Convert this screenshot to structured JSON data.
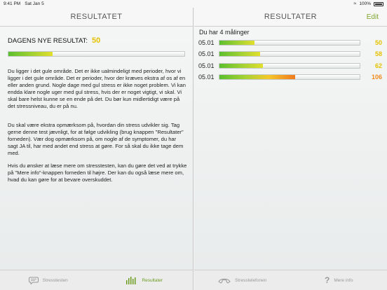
{
  "status_bar": {
    "time": "9:41 PM",
    "date": "Sat Jan 5",
    "battery": "100%"
  },
  "left_pane": {
    "title": "RESULTATET",
    "result_label": "DAGENS NYE RESULTAT:",
    "result_value": "50",
    "result_fraction": 0.25,
    "paragraphs": [
      "Du ligger i det gule område. Det er ikke ualmindeligt med perioder, hvor vi ligger i det gule område. Det er perioder, hvor der kræves ekstra af os af en eller anden grund. Nogle dage med gul stress er ikke noget problem. Vi kan endda klare nogle uger med gul stress, hvis der er noget vigtigt, vi skal. Vi skal bare helst kunne se en ende på det. Du bør kun midlertidigt være på det stressniveau, du er på nu.",
      "Du skal være ekstra opmærksom på, hvordan din stress udvikler sig. Tag gerne denne test jævnligt, for at følge udvikling (brug knappen \"Resultater\" forneden). Vær dog opmærksom på, om nogle af de symptomer, du har sagt JA til, har med andet end stress at gøre. For så skal du ikke tage dem med.",
      "Hvis du ønsker at læse mere om stresstesten, kan du gøre det ved at trykke på \"Mere info\"-knappen forneden til højre. Der kan du også læse mere om, hvad du kan gøre for at bevare overskuddet."
    ]
  },
  "right_pane": {
    "title": "RESULTATER",
    "edit_label": "Edit",
    "count_label": "Du har 4 målinger",
    "measurements": [
      {
        "date": "05.01",
        "value": "50",
        "fraction": 0.25,
        "color": "#e6c200"
      },
      {
        "date": "05.01",
        "value": "58",
        "fraction": 0.29,
        "color": "#e6c200"
      },
      {
        "date": "05.01",
        "value": "62",
        "fraction": 0.31,
        "color": "#e6c200"
      },
      {
        "date": "05.01",
        "value": "106",
        "fraction": 0.54,
        "color": "#f08a1e"
      }
    ]
  },
  "tabs": [
    {
      "label": "Stresstesten",
      "icon": "chat-bubble-icon",
      "active": false
    },
    {
      "label": "Resultater",
      "icon": "bar-chart-icon",
      "active": true
    },
    {
      "label": "Stresstelefonen",
      "icon": "phone-icon",
      "active": false
    },
    {
      "label": "Mere info",
      "icon": "question-mark-icon",
      "active": false
    }
  ],
  "colors": {
    "accent": "#7fa32a",
    "yellow_value": "#e6c200",
    "orange_value": "#f08a1e"
  }
}
